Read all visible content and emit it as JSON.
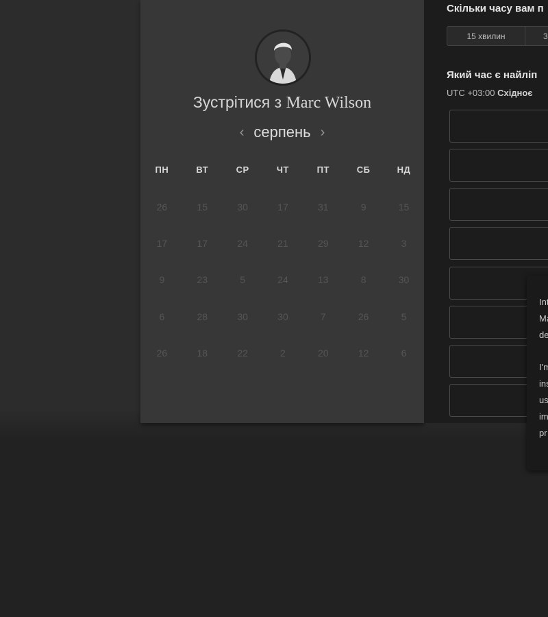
{
  "host": {
    "title_prefix": "Зустрітися з",
    "name": "Marc Wilson"
  },
  "calendar": {
    "month": "серпень",
    "weekdays": [
      "ПН",
      "ВТ",
      "СР",
      "ЧТ",
      "ПТ",
      "СБ",
      "НД"
    ],
    "weeks": [
      [
        "26",
        "15",
        "30",
        "17",
        "31",
        "9",
        "15"
      ],
      [
        "17",
        "17",
        "24",
        "21",
        "29",
        "12",
        "3"
      ],
      [
        "9",
        "23",
        "5",
        "24",
        "13",
        "8",
        "30"
      ],
      [
        "6",
        "28",
        "30",
        "30",
        "7",
        "26",
        "5"
      ],
      [
        "26",
        "18",
        "22",
        "2",
        "20",
        "12",
        "6"
      ]
    ]
  },
  "booking": {
    "duration_question": "Скільки часу вам п",
    "durations": [
      "15 хвилин",
      "3"
    ],
    "time_question": "Який час є найліп",
    "timezone_offset": "UTC +03:00",
    "timezone_name": "Східноє"
  },
  "popup": {
    "lines": [
      "Int",
      "Ma",
      "de",
      "",
      "I'm",
      "ins",
      "us",
      "im",
      "pr"
    ]
  },
  "colors": {
    "page_background": "#222222",
    "card_background": "#373737",
    "panel_background": "#1c1c1c",
    "muted_day_text": "#555555"
  }
}
